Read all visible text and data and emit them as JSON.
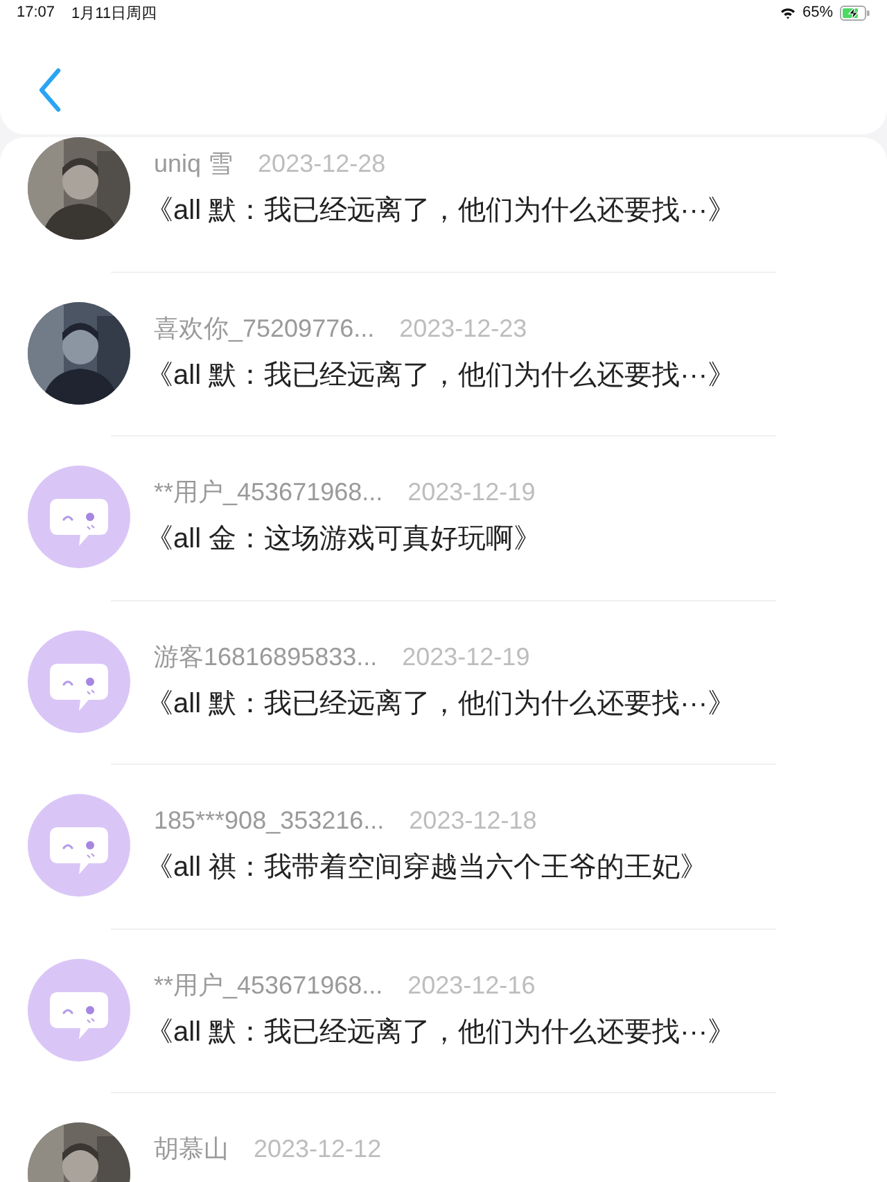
{
  "status_bar": {
    "time": "17:07",
    "date": "1月11日周四",
    "battery": "65%"
  },
  "rows": [
    {
      "name": "uniq 雪",
      "date": "2023-12-28",
      "title": "《all 默：我已经远离了，他们为什么还要找···》"
    },
    {
      "name": "喜欢你_75209776...",
      "date": "2023-12-23",
      "title": "《all 默：我已经远离了，他们为什么还要找···》"
    },
    {
      "avatar": {
        "kind": "default"
      },
      "name": "**用户_453671968...",
      "date": "2023-12-19",
      "title": "《all 金：这场游戏可真好玩啊》"
    },
    {
      "avatar": {
        "kind": "default"
      },
      "name": "游客16816895833...",
      "date": "2023-12-19",
      "title": "《all 默：我已经远离了，他们为什么还要找···》"
    },
    {
      "avatar": {
        "kind": "default"
      },
      "name": "185***908_353216...",
      "date": "2023-12-18",
      "title": "《all 祺：我带着空间穿越当六个王爷的王妃》"
    },
    {
      "avatar": {
        "kind": "default"
      },
      "name": "**用户_453671968...",
      "date": "2023-12-16",
      "title": "《all 默：我已经远离了，他们为什么还要找···》"
    },
    {
      "name": "胡慕山",
      "date": "2023-12-12"
    }
  ]
}
